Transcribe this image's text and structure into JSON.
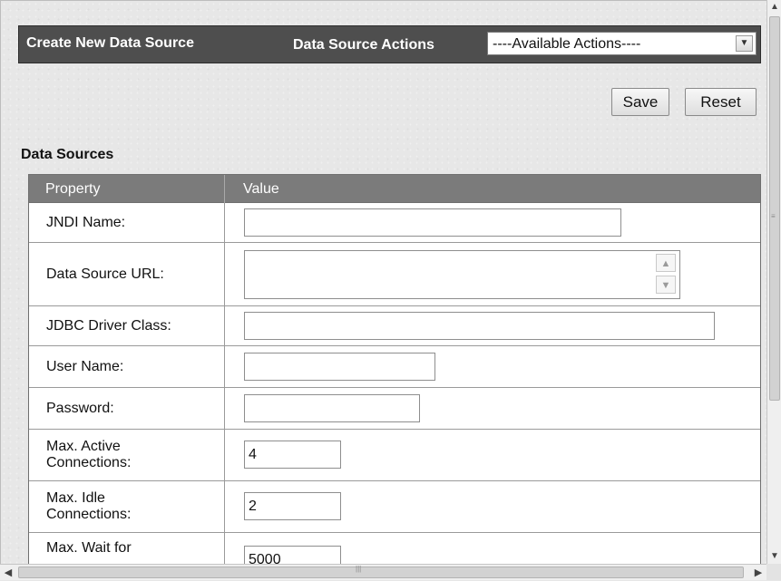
{
  "header": {
    "title": "Create New Data Source",
    "actions_label": "Data Source Actions",
    "actions_selected": "----Available Actions----"
  },
  "buttons": {
    "save": "Save",
    "reset": "Reset"
  },
  "section_heading": "Data Sources",
  "table": {
    "columns": [
      "Property",
      "Value"
    ],
    "rows": [
      {
        "label": "JNDI Name:",
        "value": ""
      },
      {
        "label": "Data Source URL:",
        "value": ""
      },
      {
        "label": "JDBC Driver Class:",
        "value": ""
      },
      {
        "label": "User Name:",
        "value": ""
      },
      {
        "label": "Password:",
        "value": ""
      },
      {
        "label": "Max. Active Connections:",
        "value": "4"
      },
      {
        "label": "Max. Idle Connections:",
        "value": "2"
      },
      {
        "label": "Max. Wait for",
        "value": "5000"
      }
    ]
  },
  "icons": {
    "select_arrow": "chevron-down-icon",
    "scroll_up": "arrow-up-icon",
    "scroll_down": "arrow-down-icon",
    "scroll_left": "arrow-left-icon",
    "scroll_right": "arrow-right-icon"
  },
  "colors": {
    "header_bar": "#4e4e4e",
    "table_header": "#7b7b7b",
    "page_background": "#e7e7e7"
  }
}
